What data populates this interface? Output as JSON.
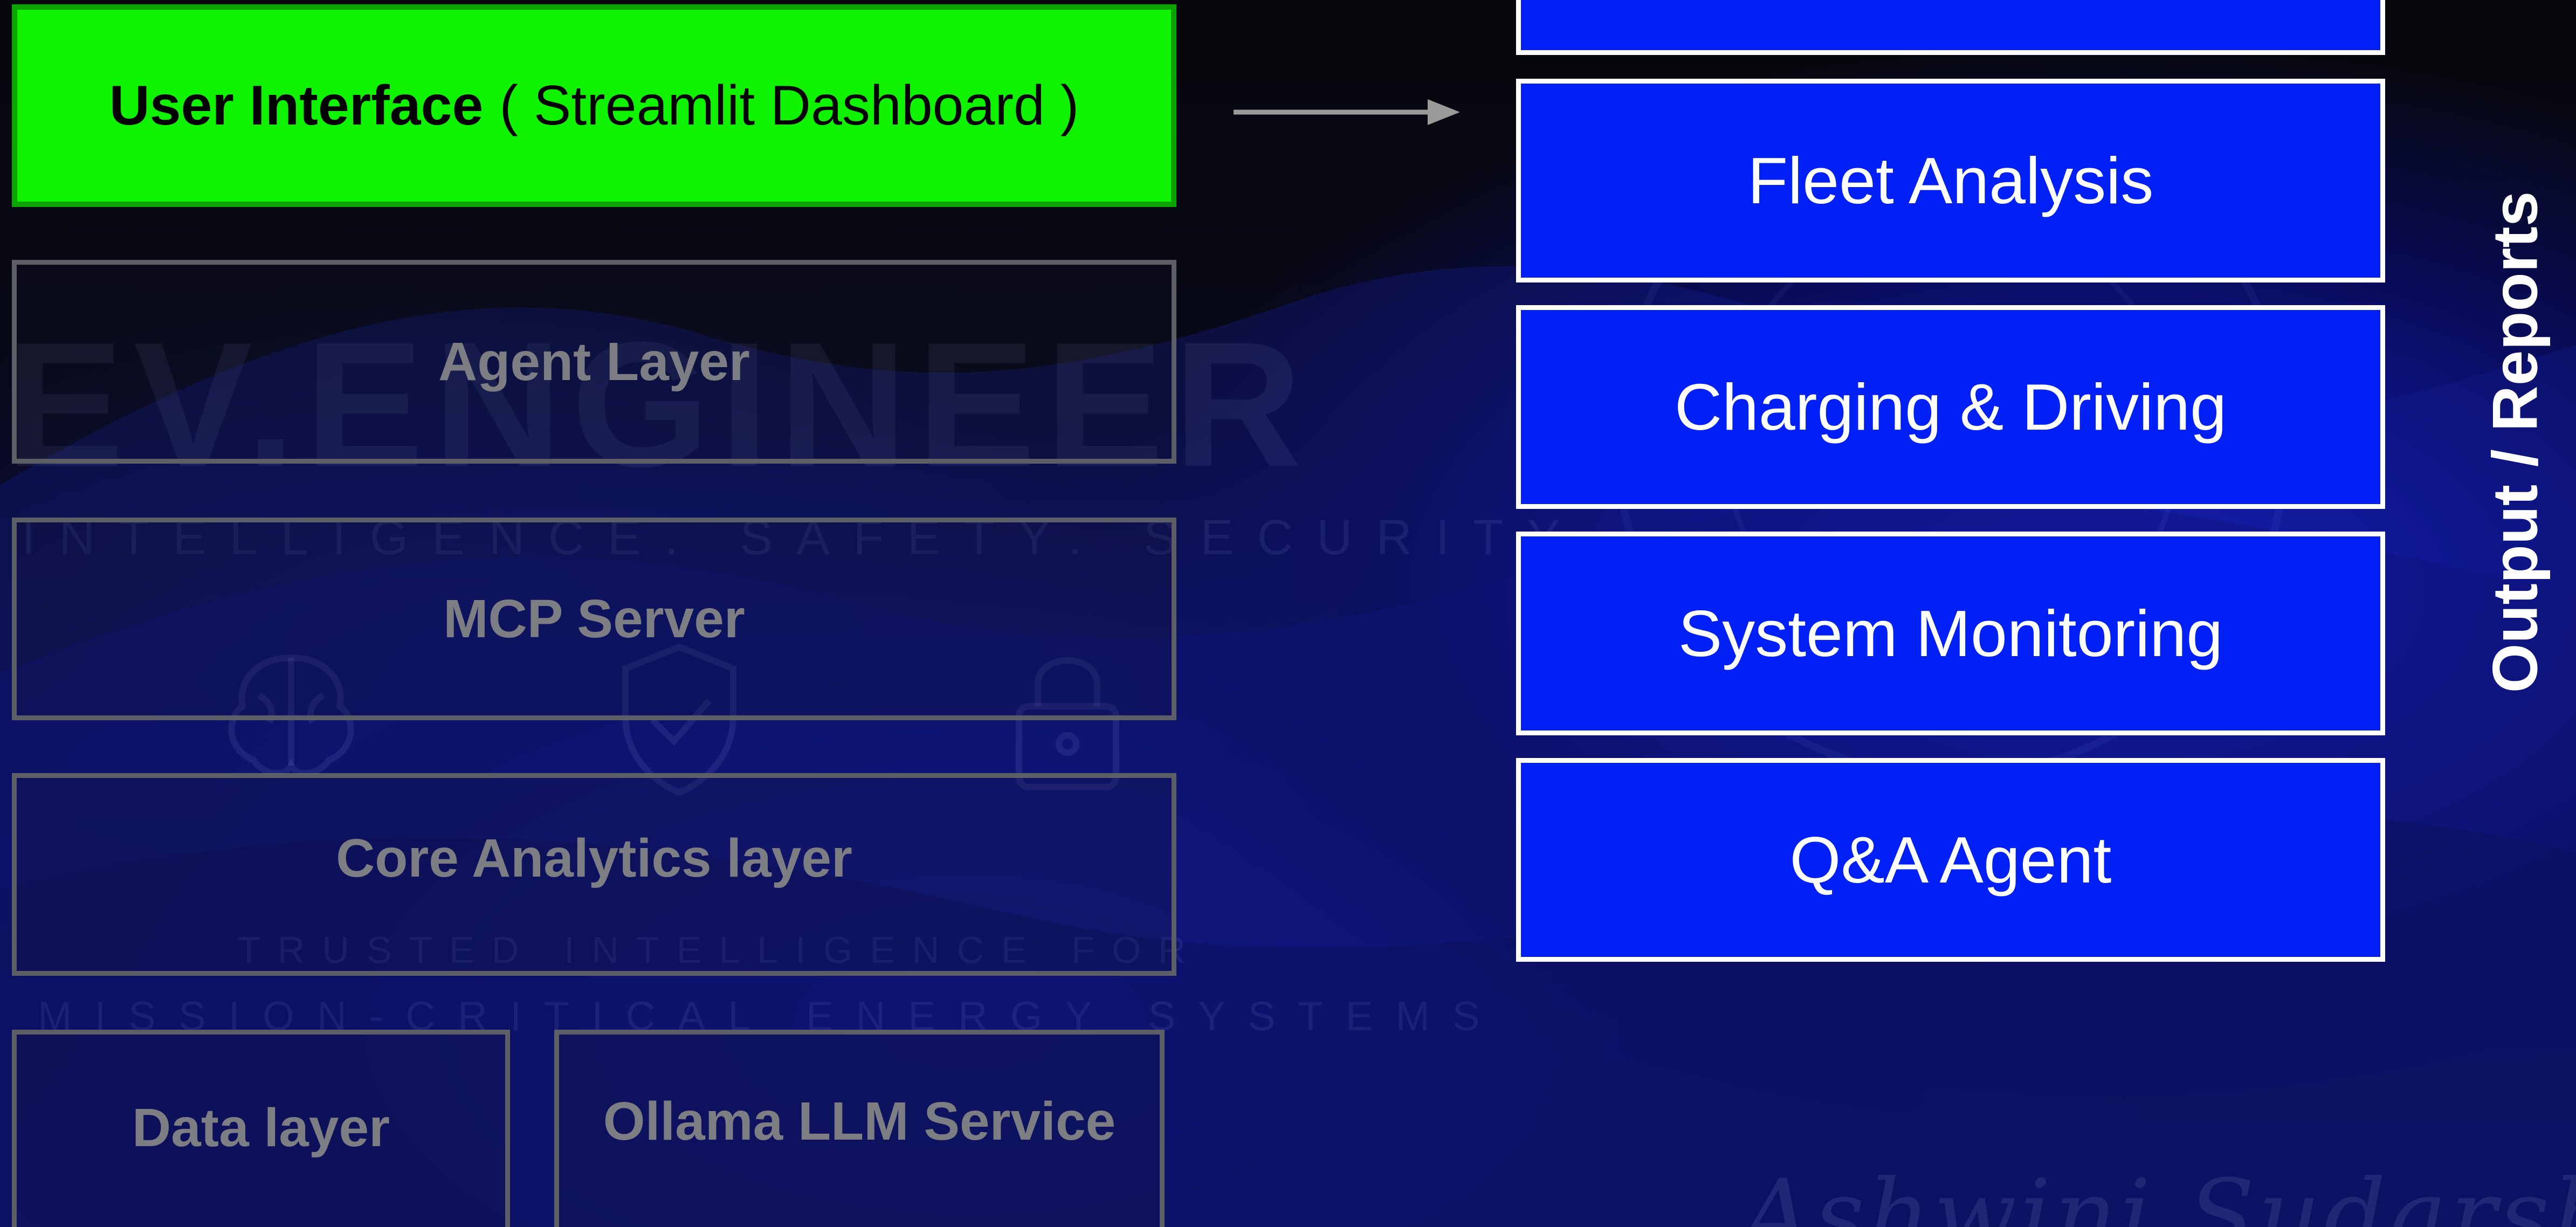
{
  "user_interface": {
    "bold_label": "User Interface",
    "label_suffix": "( Streamlit Dashboard )"
  },
  "layers": {
    "agent": "Agent Layer",
    "mcp": "MCP Server",
    "core_analytics": "Core Analytics layer",
    "data": "Data layer",
    "ollama": "Ollama LLM Service"
  },
  "outputs": {
    "top_partial": "",
    "items": [
      "Fleet Analysis",
      "Charging & Driving",
      "System Monitoring",
      "Q&A Agent"
    ],
    "side_label": "Output / Reports"
  },
  "watermark": {
    "brand": "EV.ENGINEER",
    "tagline": "INTELLIGENCE. SAFETY. SECURITY.",
    "trusted": "TRUSTED INTELLIGENCE FOR",
    "mission": "MISSION-CRITICAL ENERGY SYSTEMS",
    "signature": "Ashwini Sudarshan"
  },
  "colors": {
    "ui_fill": "#0ff300",
    "output_fill": "#0020f5",
    "layer_border": "#5d5f66",
    "layer_text": "#7d7e83",
    "arrow": "#9a9a9a"
  }
}
